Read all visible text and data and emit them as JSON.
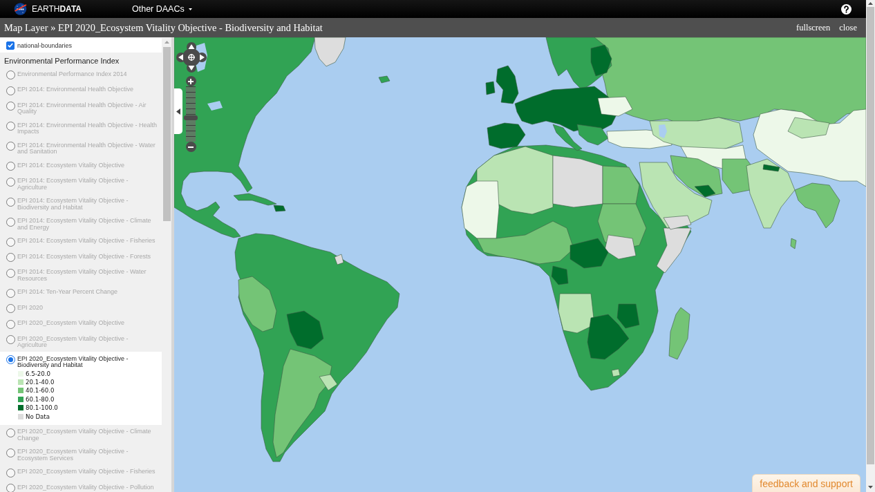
{
  "header": {
    "brand": "EARTH**DATA**",
    "menu": "Other DAACs"
  },
  "title_bar": {
    "title": "Map Layer » EPI 2020_Ecosystem Vitality Objective - Biodiversity and Habitat",
    "actions": [
      "fullscreen",
      "close"
    ]
  },
  "sidebar": {
    "overlay": {
      "label": "national-boundaries",
      "checked": true
    },
    "heading": "Environmental Performance Index",
    "layers": [
      {
        "label": "Environmental Performance Index 2014",
        "selected": false
      },
      {
        "label": "EPI 2014: Environmental Health Objective",
        "selected": false
      },
      {
        "label": "EPI 2014: Environmental Health Objective - Air Quality",
        "selected": false
      },
      {
        "label": "EPI 2014: Environmental Health Objective - Health Impacts",
        "selected": false
      },
      {
        "label": "EPI 2014: Environmental Health Objective - Water and Sanitation",
        "selected": false
      },
      {
        "label": "EPI 2014: Ecosystem Vitality Objective",
        "selected": false
      },
      {
        "label": "EPI 2014: Ecosystem Vitality Objective - Agriculture",
        "selected": false
      },
      {
        "label": "EPI 2014: Ecosystem Vitality Objective - Biodiversity and Habitat",
        "selected": false
      },
      {
        "label": "EPI 2014: Ecosystem Vitality Objective - Climate and Energy",
        "selected": false
      },
      {
        "label": "EPI 2014: Ecosystem Vitality Objective - Fisheries",
        "selected": false
      },
      {
        "label": "EPI 2014: Ecosystem Vitality Objective - Forests",
        "selected": false
      },
      {
        "label": "EPI 2014: Ecosystem Vitality Objective - Water Resources",
        "selected": false
      },
      {
        "label": "EPI 2014: Ten-Year Percent Change",
        "selected": false
      },
      {
        "label": "EPI 2020",
        "selected": false
      },
      {
        "label": "EPI 2020_Ecosystem Vitality Objective",
        "selected": false
      },
      {
        "label": "EPI 2020_Ecosystem Vitality Objective - Agriculture",
        "selected": false
      },
      {
        "label": "EPI 2020_Ecosystem Vitality Objective - Biodiversity and Habitat",
        "selected": true,
        "legend": [
          {
            "label": "6.5-20.0",
            "color": "#edf8e9"
          },
          {
            "label": "20.1-40.0",
            "color": "#bae4b3"
          },
          {
            "label": "40.1-60.0",
            "color": "#74c476"
          },
          {
            "label": "60.1-80.0",
            "color": "#31a354"
          },
          {
            "label": "80.1-100.0",
            "color": "#006d2c"
          },
          {
            "label": "No Data",
            "color": "#dddddd"
          }
        ]
      },
      {
        "label": "EPI 2020_Ecosystem Vitality Objective - Climate Change",
        "selected": false
      },
      {
        "label": "EPI 2020_Ecosystem Vitality Objective - Ecosystem Services",
        "selected": false
      },
      {
        "label": "EPI 2020_Ecosystem Vitality Objective - Fisheries",
        "selected": false
      },
      {
        "label": "EPI 2020_Ecosystem Vitality Objective - Pollution",
        "selected": false
      }
    ]
  },
  "map": {
    "zoom": {
      "level": 0.43
    }
  },
  "feedback_button": "feedback and support"
}
